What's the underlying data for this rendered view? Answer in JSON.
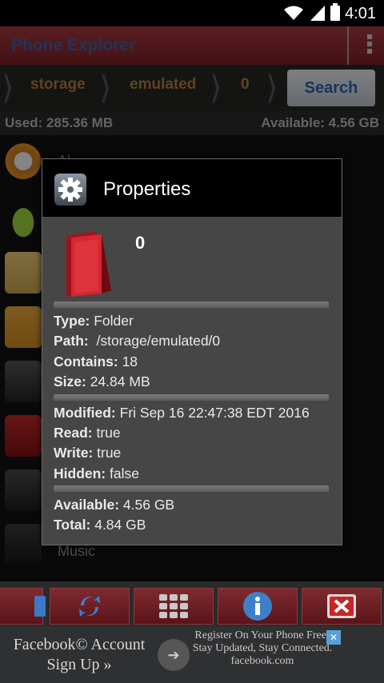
{
  "status_bar": {
    "time": "4:01"
  },
  "app": {
    "title": "Phone Explorer"
  },
  "breadcrumb": {
    "segments": [
      "storage",
      "emulated",
      "0"
    ],
    "search_label": "Search"
  },
  "storage": {
    "used": "Used: 285.36 MB",
    "available": "Available: 4.56 GB"
  },
  "file_list": {
    "items": [
      "Al",
      "Music"
    ]
  },
  "dialog": {
    "title": "Properties",
    "folder_name": "0",
    "props": [
      {
        "k": "Type:",
        "v": " Folder"
      },
      {
        "k": "Path:",
        "v": "  /storage/emulated/0"
      },
      {
        "k": "Contains:",
        "v": " 18"
      },
      {
        "k": "Size:",
        "v": " 24.84 MB"
      },
      {
        "k": "Modified:",
        "v": " Fri Sep 16 22:47:38 EDT 2016"
      },
      {
        "k": "Read:",
        "v": " true"
      },
      {
        "k": "Write:",
        "v": " true"
      },
      {
        "k": "Hidden:",
        "v": " false"
      },
      {
        "k": "Available:",
        "v": " 4.56 GB"
      },
      {
        "k": "Total:",
        "v": " 4.84 GB"
      }
    ]
  },
  "toolbar": {
    "icons": [
      "sdcard-icon",
      "refresh-icon",
      "grid-icon",
      "info-icon",
      "close-icon"
    ]
  },
  "ad": {
    "left_line1": "Facebook© Account",
    "left_line2": "Sign Up »",
    "right_text": "Register On Your Phone Free! Stay Updated, Stay Connected.",
    "domain": "facebook.com"
  },
  "colors": {
    "accent": "#a13a3f",
    "search_text": "#2c62a7",
    "breadcrumb_text": "#b07b3a"
  }
}
